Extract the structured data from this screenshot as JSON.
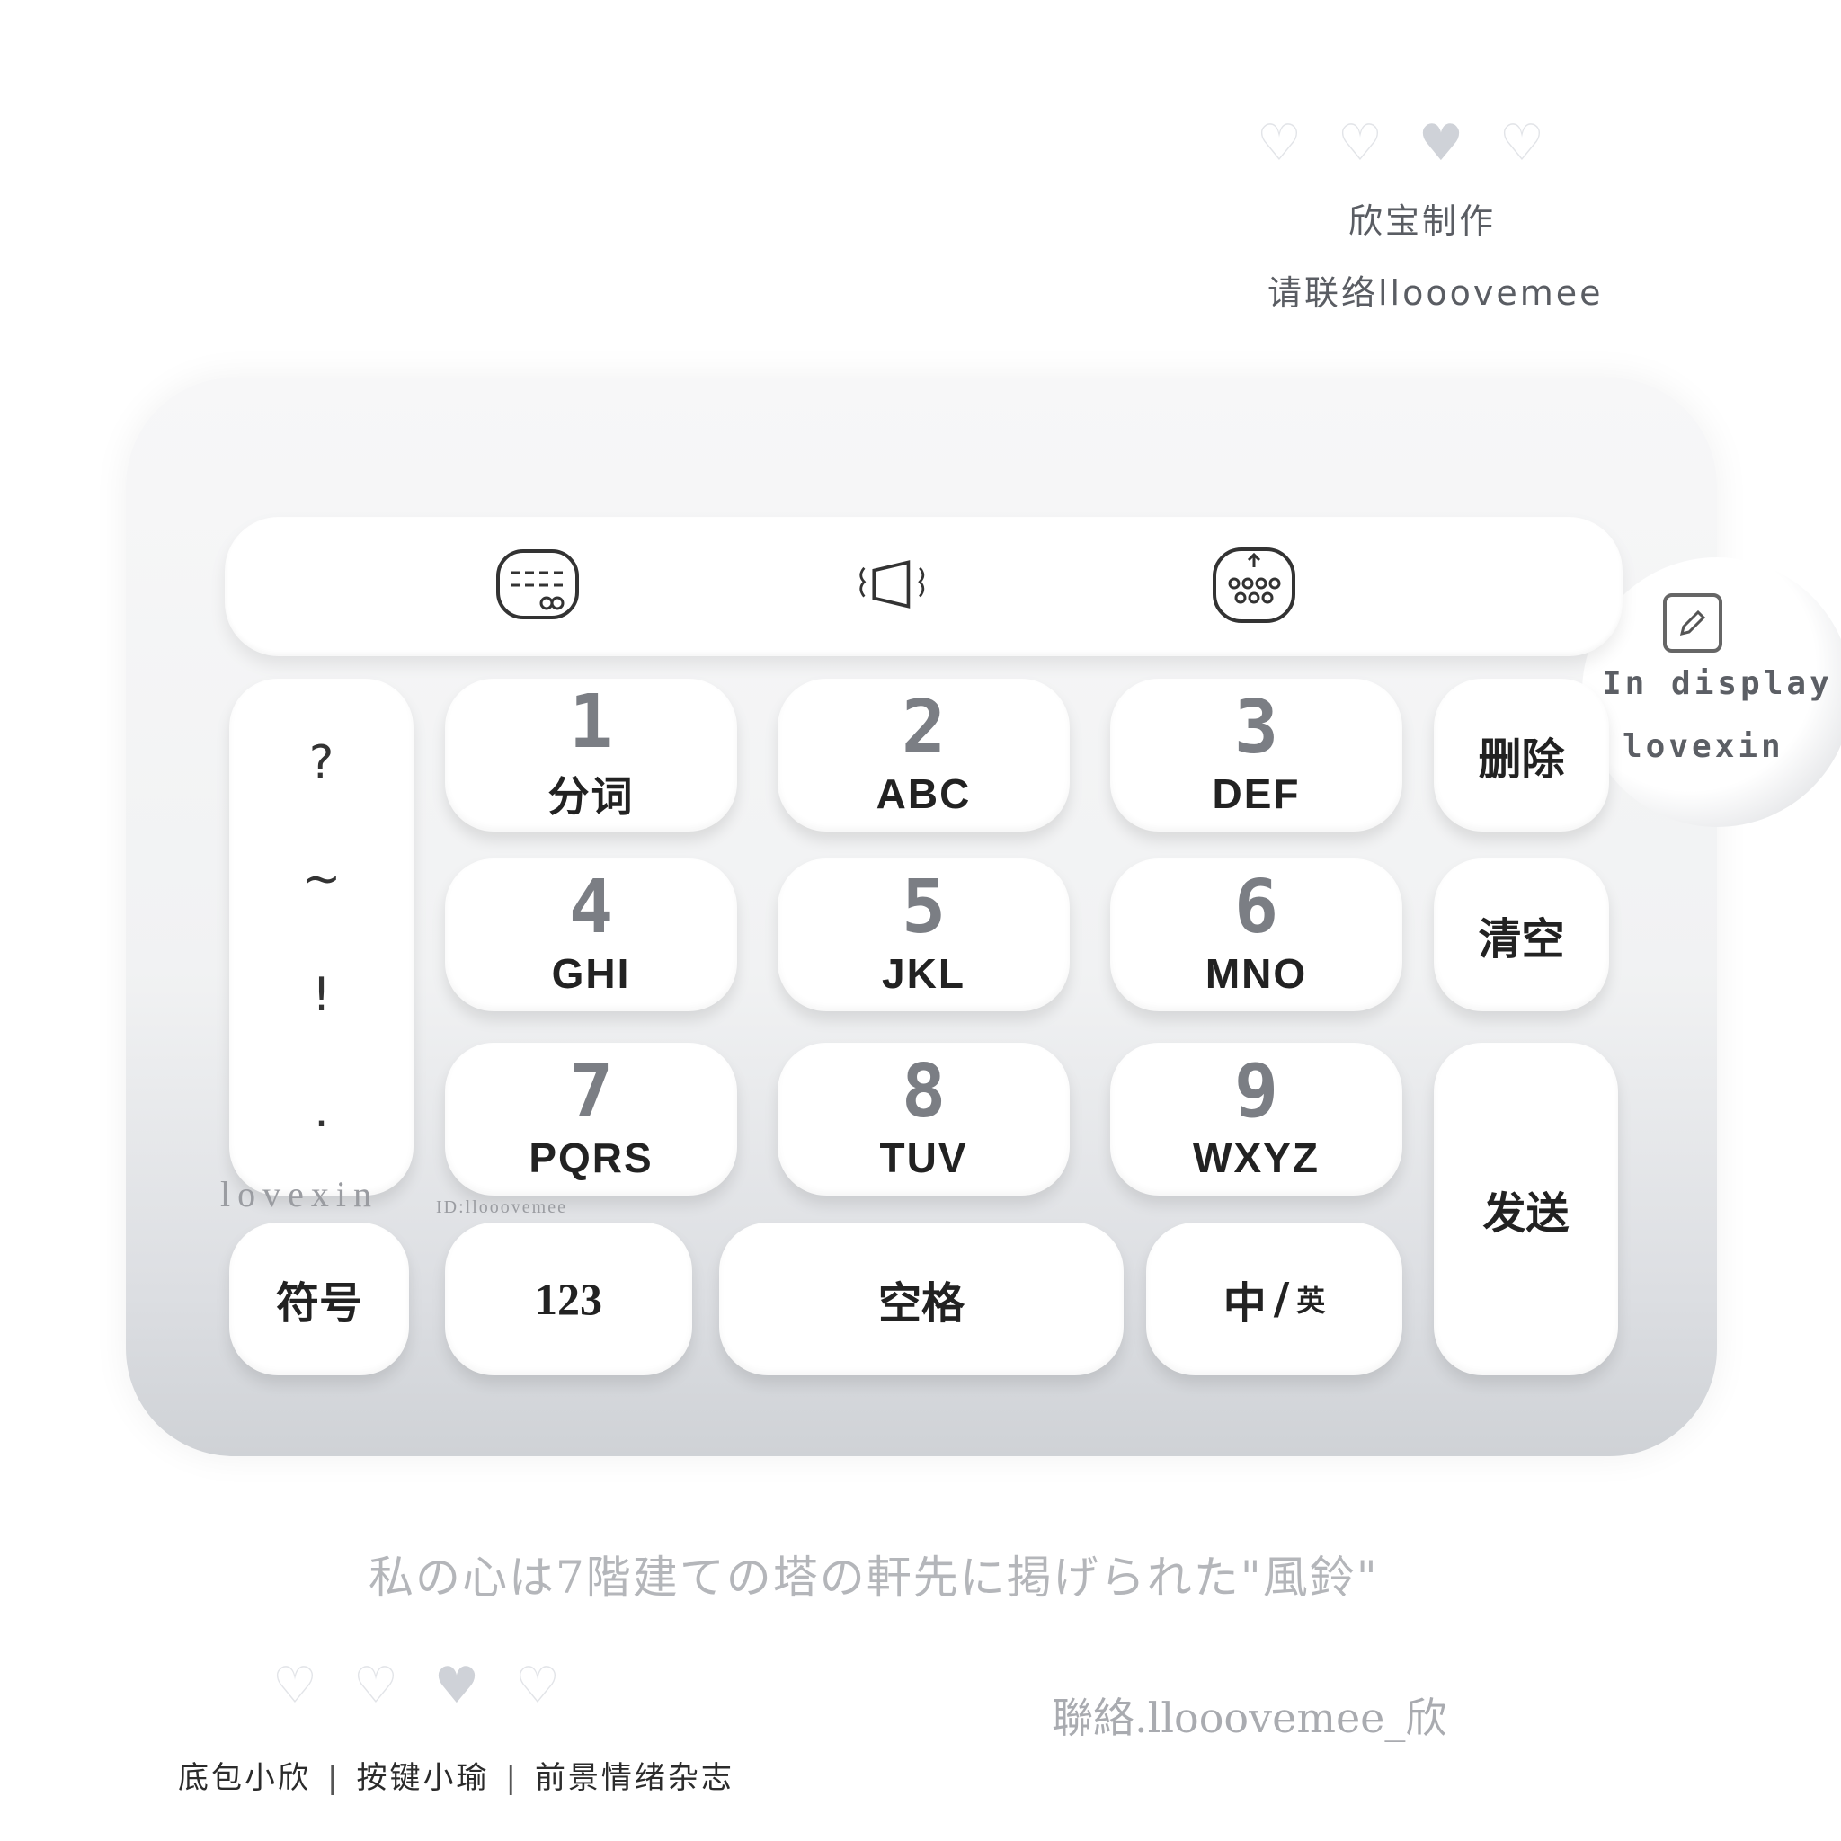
{
  "header": {
    "hearts": [
      "heart-outline",
      "heart-outline",
      "heart-filled",
      "heart-outline"
    ],
    "credit_title": "欣宝制作",
    "credit_contact": "请联络llooovemee"
  },
  "toolbar": {
    "icons": [
      "card-pattern-icon",
      "vibrate-icon",
      "keyboard-skin-icon"
    ]
  },
  "display_badge": {
    "line1": "In display",
    "line2": "lovexin",
    "icon": "edit-icon"
  },
  "symbols": {
    "items": [
      "?",
      "~",
      "!",
      "."
    ]
  },
  "keys": {
    "k1": {
      "digit": "1",
      "letters": "分词"
    },
    "k2": {
      "digit": "2",
      "letters": "ABC"
    },
    "k3": {
      "digit": "3",
      "letters": "DEF"
    },
    "k4": {
      "digit": "4",
      "letters": "GHI"
    },
    "k5": {
      "digit": "5",
      "letters": "JKL"
    },
    "k6": {
      "digit": "6",
      "letters": "MNO"
    },
    "k7": {
      "digit": "7",
      "letters": "PQRS"
    },
    "k8": {
      "digit": "8",
      "letters": "TUV"
    },
    "k9": {
      "digit": "9",
      "letters": "WXYZ"
    }
  },
  "side_keys": {
    "delete": "删除",
    "clear": "清空",
    "send": "发送"
  },
  "bottom_keys": {
    "symbol": "符号",
    "num": "123",
    "space": "空格",
    "lang_main": "中",
    "lang_sep": "/",
    "lang_alt": "英"
  },
  "watermarks": {
    "brand": "lovexin",
    "id": "ID:llooovemee"
  },
  "footer": {
    "jp_line": "私の心は7階建ての塔の軒先に掲げられた\"風鈴\"",
    "contact": "聯絡.llooovemee_欣",
    "hearts": [
      "heart-outline",
      "heart-outline",
      "heart-filled",
      "heart-outline"
    ],
    "tagline_parts": [
      "底包小欣",
      "按键小瑜",
      "前景情绪杂志"
    ],
    "tagline_sep": "|"
  }
}
